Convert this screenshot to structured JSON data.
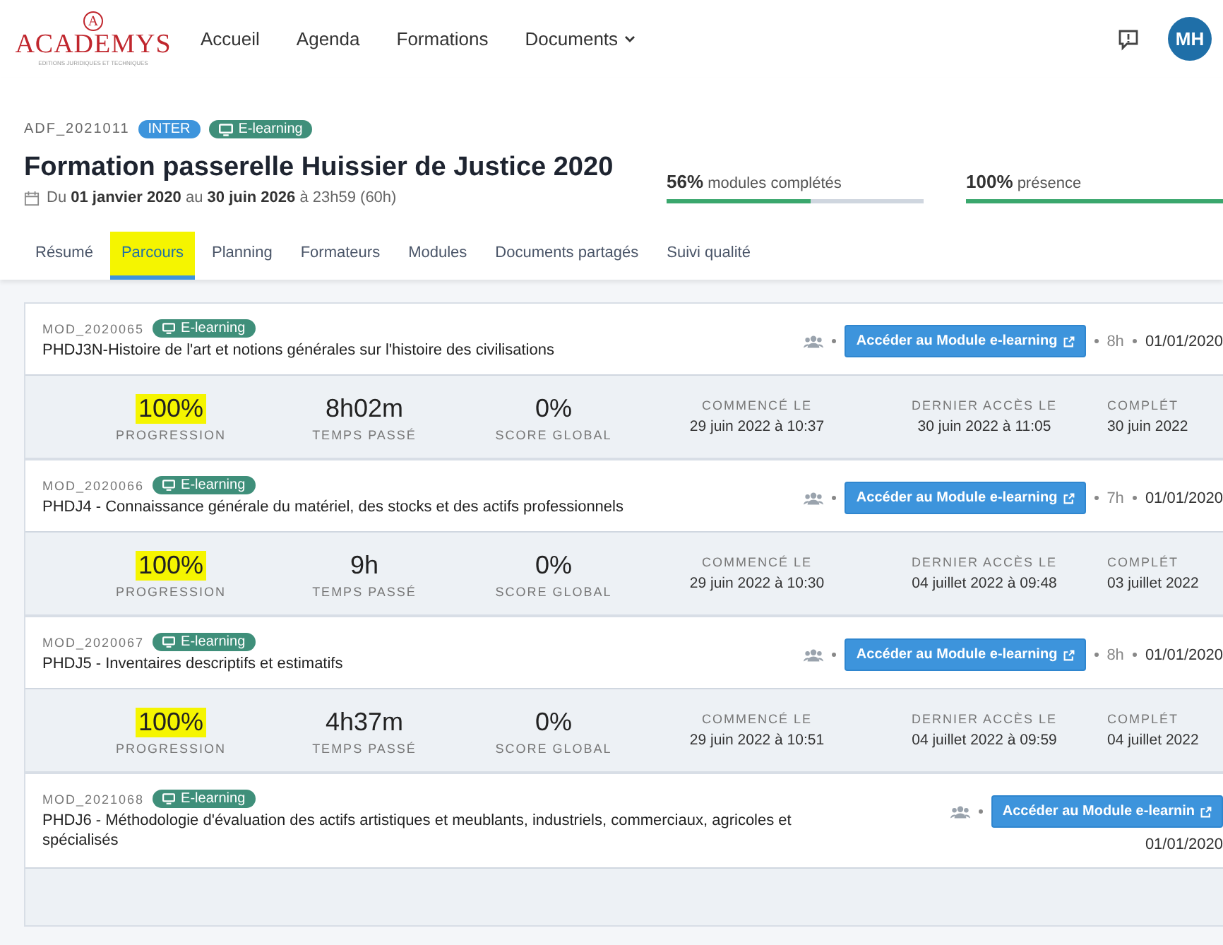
{
  "logo": {
    "name": "ACADEMYS",
    "tagline": "EDITIONS JURIDIQUES ET TECHNIQUES",
    "letter": "A"
  },
  "nav": [
    {
      "label": "Accueil",
      "dropdown": false
    },
    {
      "label": "Agenda",
      "dropdown": false
    },
    {
      "label": "Formations",
      "dropdown": false
    },
    {
      "label": "Documents",
      "dropdown": true
    }
  ],
  "user": {
    "initials": "MH"
  },
  "course": {
    "code": "ADF_2021011",
    "badges": [
      {
        "label": "INTER",
        "kind": "plain",
        "color": "#3d94dc"
      },
      {
        "label": "E-learning",
        "kind": "elearning",
        "color": "#3f8f7a"
      }
    ],
    "title": "Formation passerelle Huissier de Justice 2020",
    "dates": "Du **01 janvier 2020** au **30 juin 2026** à 23h59 (60h)",
    "progress": [
      {
        "value": "56%",
        "label": "modules complétés",
        "level": 0.56
      },
      {
        "value": "100%",
        "label": "présence",
        "level": 1
      }
    ]
  },
  "tabs": [
    {
      "label": "Résumé",
      "selected": false,
      "highlighted": false
    },
    {
      "label": "Parcours",
      "selected": true,
      "highlighted": true
    },
    {
      "label": "Planning",
      "selected": false,
      "highlighted": false
    },
    {
      "label": "Formateurs",
      "selected": false,
      "highlighted": false
    },
    {
      "label": "Modules",
      "selected": false,
      "highlighted": false
    },
    {
      "label": "Documents partagés",
      "selected": false,
      "highlighted": false
    },
    {
      "label": "Suivi qualité",
      "selected": false,
      "highlighted": false
    }
  ],
  "modules": [
    {
      "code": "MOD_2020065",
      "badge": "E-learning",
      "title": "PHDJ3N-Histoire de l'art et notions générales sur l'histoire des civilisations",
      "button": "Accéder au Module e-learning",
      "hours": "8h",
      "date": "01/01/2020",
      "date_wrapped": false,
      "stats": [
        {
          "value": "100%",
          "label": "PROGRESSION",
          "highlighted": true
        },
        {
          "value": "8h02m",
          "label": "TEMPS PASSÉ",
          "highlighted": false
        },
        {
          "value": "0%",
          "label": "SCORE GLOBAL",
          "highlighted": false
        }
      ],
      "dates": [
        {
          "label": "COMMENCÉ LE",
          "value": "29 juin 2022 à 10:37"
        },
        {
          "label": "DERNIER ACCÈS LE",
          "value": "30 juin 2022 à 11:05"
        },
        {
          "label": "COMPLÉT",
          "value": "30 juin 2022"
        }
      ]
    },
    {
      "code": "MOD_2020066",
      "badge": "E-learning",
      "title": "PHDJ4 - Connaissance générale du matériel, des stocks et des actifs professionnels",
      "button": "Accéder au Module e-learning",
      "hours": "7h",
      "date": "01/01/2020",
      "date_wrapped": false,
      "stats": [
        {
          "value": "100%",
          "label": "PROGRESSION",
          "highlighted": true
        },
        {
          "value": "9h",
          "label": "TEMPS PASSÉ",
          "highlighted": false
        },
        {
          "value": "0%",
          "label": "SCORE GLOBAL",
          "highlighted": false
        }
      ],
      "dates": [
        {
          "label": "COMMENCÉ LE",
          "value": "29 juin 2022 à 10:30"
        },
        {
          "label": "DERNIER ACCÈS LE",
          "value": "04 juillet 2022 à 09:48"
        },
        {
          "label": "COMPLÉT",
          "value": "03 juillet 2022"
        }
      ]
    },
    {
      "code": "MOD_2020067",
      "badge": "E-learning",
      "title": "PHDJ5 - Inventaires descriptifs et estimatifs",
      "button": "Accéder au Module e-learning",
      "hours": "8h",
      "date": "01/01/2020",
      "date_wrapped": false,
      "stats": [
        {
          "value": "100%",
          "label": "PROGRESSION",
          "highlighted": true
        },
        {
          "value": "4h37m",
          "label": "TEMPS PASSÉ",
          "highlighted": false
        },
        {
          "value": "0%",
          "label": "SCORE GLOBAL",
          "highlighted": false
        }
      ],
      "dates": [
        {
          "label": "COMMENCÉ LE",
          "value": "29 juin 2022 à 10:51"
        },
        {
          "label": "DERNIER ACCÈS LE",
          "value": "04 juillet 2022 à 09:59"
        },
        {
          "label": "COMPLÉT",
          "value": "04 juillet 2022"
        }
      ]
    },
    {
      "code": "MOD_2021068",
      "badge": "E-learning",
      "title": "PHDJ6 - Méthodologie d'évaluation des actifs artistiques et meublants, industriels, commerciaux, agricoles et spécialisés",
      "button": "Accéder au Module e-learnin",
      "date": "01/01/2020",
      "date_wrapped": true
    }
  ]
}
